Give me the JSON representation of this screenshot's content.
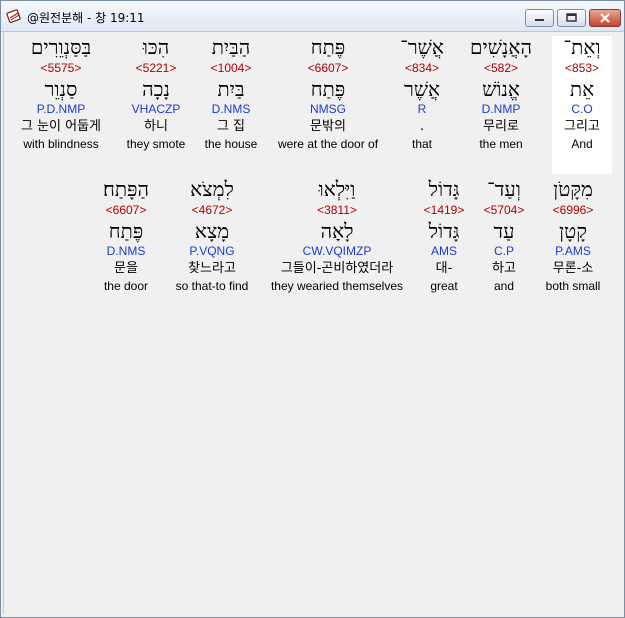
{
  "window": {
    "title": "@원전분해 - 창 19:11",
    "icon": "bible-book-icon"
  },
  "row1": [
    {
      "hebrew": "וְאֵת־",
      "strong": "<853>",
      "lemma": "אֵת",
      "morph": "C.O",
      "korean": "그리고",
      "english": "And"
    },
    {
      "hebrew": "הָאֲנָשִׁים",
      "strong": "<582>",
      "lemma": "אֱנוֹשׁ",
      "morph": "D.NMP",
      "korean": "무리로",
      "english": "the men"
    },
    {
      "hebrew": "אֲשֶׁר־",
      "strong": "<834>",
      "lemma": "אֲשֶׁר",
      "morph": "R",
      "korean": ".",
      "english": "that"
    },
    {
      "hebrew": "פֶּתַח",
      "strong": "<6607>",
      "lemma": "פֶּתַח",
      "morph": "NMSG",
      "korean": "문밖의",
      "english": "were at the door of"
    },
    {
      "hebrew": "הַבַּיִת",
      "strong": "<1004>",
      "lemma": "בַּיִת",
      "morph": "D.NMS",
      "korean": "그 집",
      "english": "the house"
    },
    {
      "hebrew": "הִכּוּ",
      "strong": "<5221>",
      "lemma": "נָכָה",
      "morph": "VHACZP",
      "korean": "하니",
      "english": "they smote"
    },
    {
      "hebrew": "בַּסַּנְוֵרִים",
      "strong": "<5575>",
      "lemma": "סַנְוֵר",
      "morph": "P.D.NMP",
      "korean": "그 눈이 어둡게",
      "english": "with blindness"
    }
  ],
  "row2": [
    {
      "hebrew": "מִקָּטֹן",
      "strong": "<6996>",
      "lemma": "קָטָן",
      "morph": "P.AMS",
      "korean": "무론-소",
      "english": "both small"
    },
    {
      "hebrew": "וְעַד־",
      "strong": "<5704>",
      "lemma": "עַד",
      "morph": "C.P",
      "korean": "하고",
      "english": "and"
    },
    {
      "hebrew": "גָּדוֹל",
      "strong": "<1419>",
      "lemma": "גָּדוֹל",
      "morph": "AMS",
      "korean": "대-",
      "english": "great"
    },
    {
      "hebrew": "וַיִּלְאוּ",
      "strong": "<3811>",
      "lemma": "לָאָה",
      "morph": "CW.VQIMZP",
      "korean": "그들이-곤비하였더라",
      "english": "they wearied themselves"
    },
    {
      "hebrew": "לִמְצֹא",
      "strong": "<4672>",
      "lemma": "מָצָא",
      "morph": "P.VQNG",
      "korean": "찾느라고",
      "english": "so that-to find"
    },
    {
      "hebrew": "הַפָּתַח׃",
      "strong": "<6607>",
      "lemma": "פֶּתַח",
      "morph": "D.NMS",
      "korean": "문을",
      "english": "the door"
    }
  ]
}
